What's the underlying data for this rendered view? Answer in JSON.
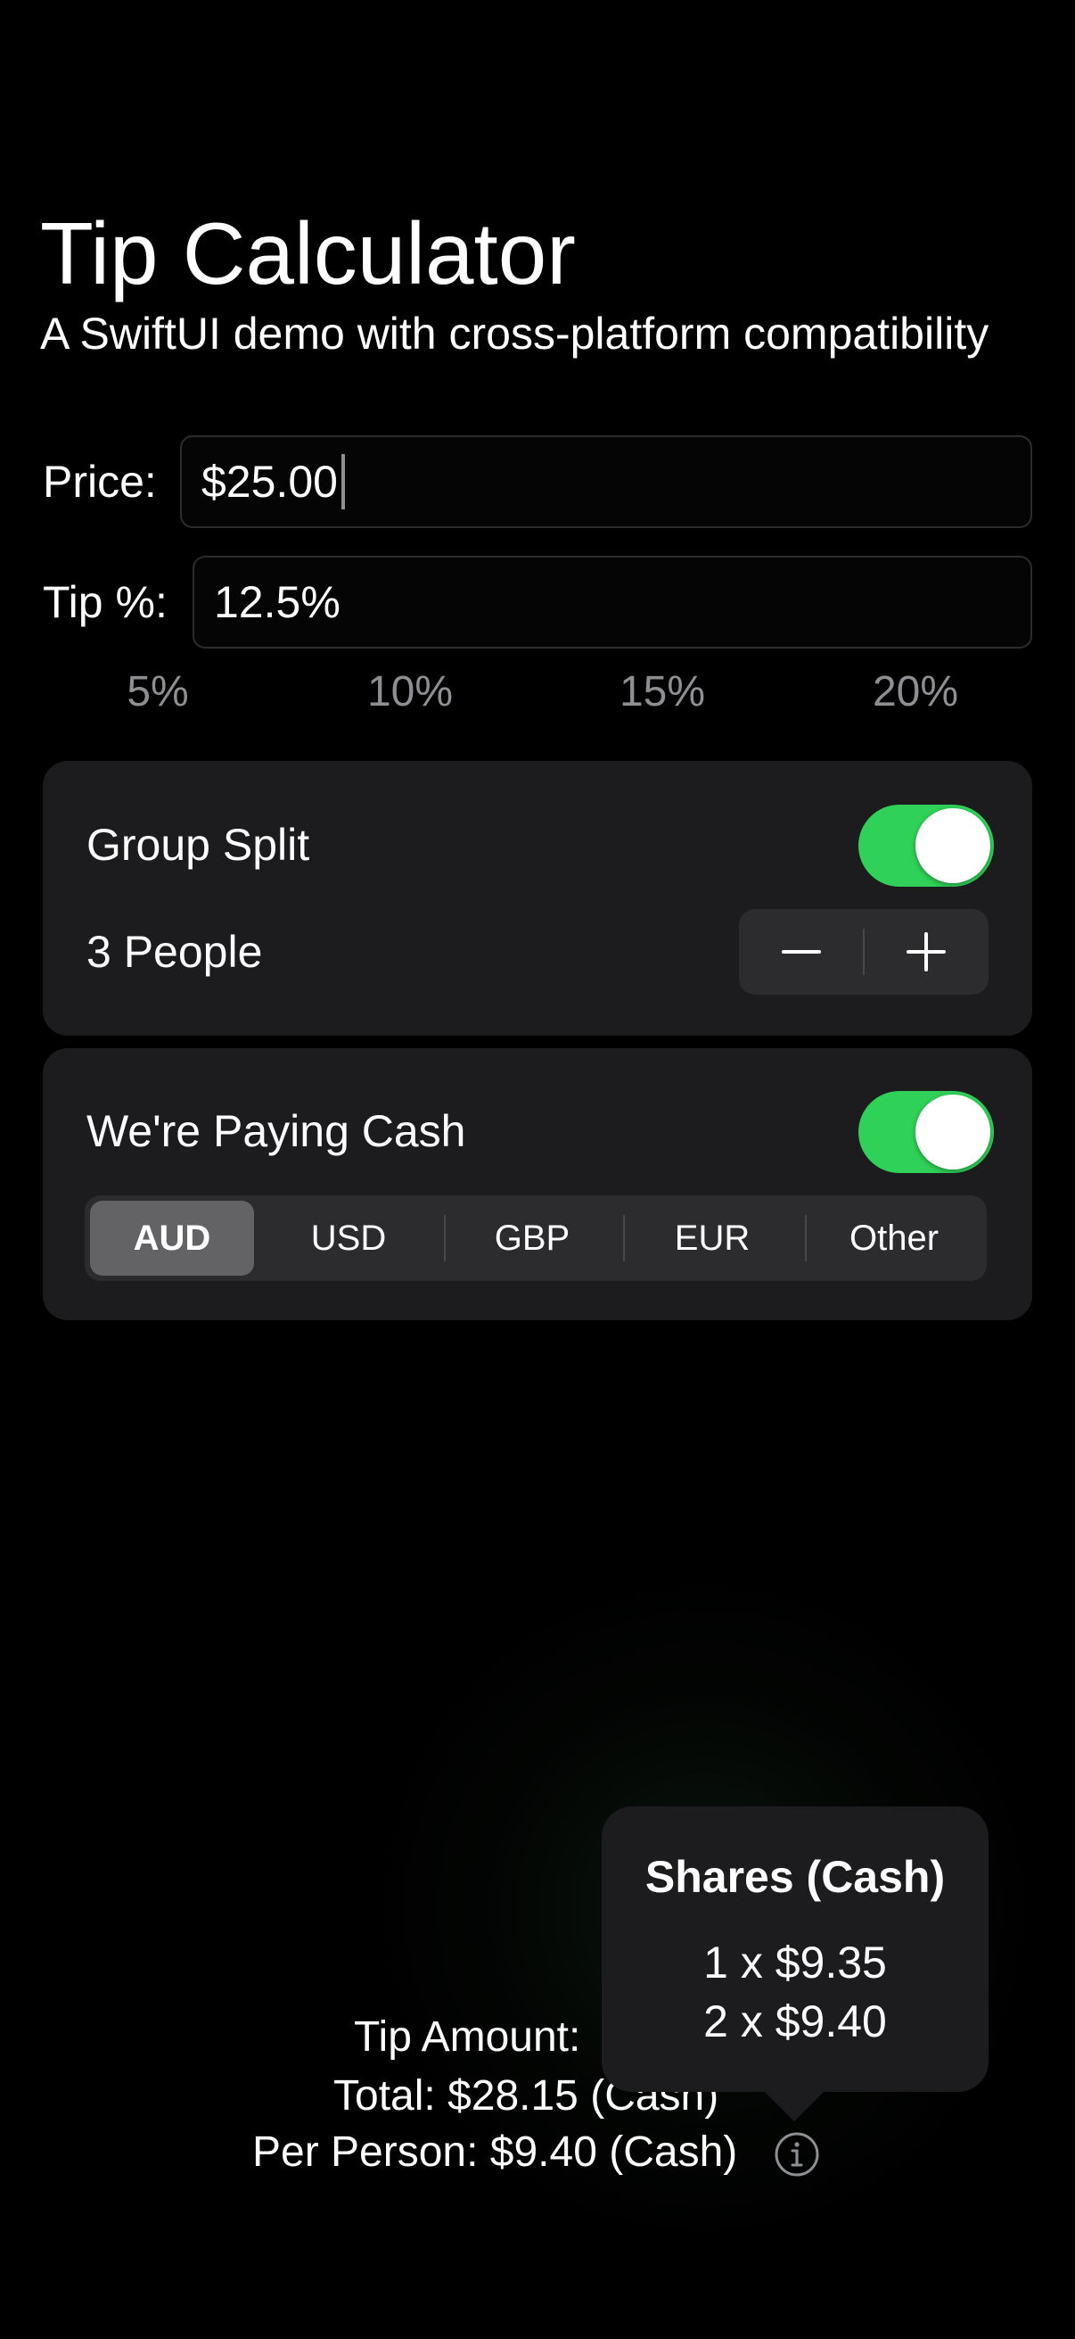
{
  "header": {
    "title": "Tip Calculator",
    "subtitle": "A SwiftUI demo with cross-platform compatibility"
  },
  "price": {
    "label": "Price:",
    "value": "$25.00"
  },
  "tip": {
    "label": "Tip %:",
    "value": "12.5%",
    "presets": [
      "5%",
      "10%",
      "15%",
      "20%"
    ]
  },
  "group_split": {
    "label": "Group Split",
    "enabled": true,
    "people_label": "3 People",
    "decrement_symbol": "−",
    "increment_symbol": "+"
  },
  "cash": {
    "label": "We're Paying Cash",
    "enabled": true,
    "currencies": [
      "AUD",
      "USD",
      "GBP",
      "EUR",
      "Other"
    ],
    "selected": "AUD"
  },
  "summary": {
    "tip_amount": "Tip Amount:",
    "total": "Total: $28.15 (Cash)",
    "per_person": "Per Person: $9.40 (Cash)"
  },
  "popover": {
    "title": "Shares (Cash)",
    "lines": [
      "1 x $9.35",
      "2 x $9.40"
    ]
  },
  "colors": {
    "accent_green": "#30d158",
    "card_background": "#1c1c1e",
    "secondary_text": "#8e8e93"
  },
  "icons": {
    "info": "info-circle-icon",
    "minus": "minus-icon",
    "plus": "plus-icon"
  }
}
